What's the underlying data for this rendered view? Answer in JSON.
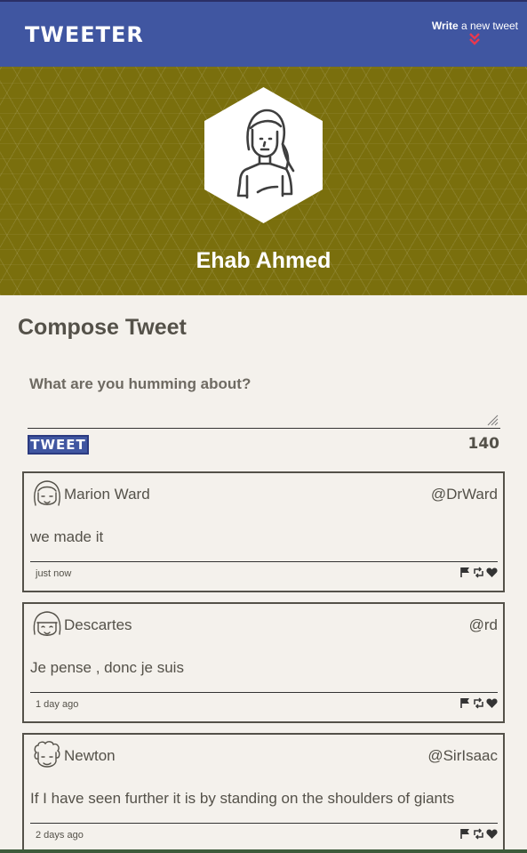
{
  "nav": {
    "logo": "TWEETER",
    "write_bold": "Write",
    "write_rest": " a new tweet"
  },
  "profile": {
    "name": "Ehab Ahmed"
  },
  "compose": {
    "title": "Compose Tweet",
    "placeholder": "What are you humming about?",
    "button_label": "TWEET",
    "counter": "140"
  },
  "tweets": [
    {
      "name": "Marion Ward",
      "handle": "@DrWard",
      "content": "we made it",
      "time": "just now",
      "avatar_icon": "girl-face-icon"
    },
    {
      "name": "Descartes",
      "handle": "@rd",
      "content": "Je pense , donc je suis",
      "time": "1 day ago",
      "avatar_icon": "bangs-face-icon"
    },
    {
      "name": "Newton",
      "handle": "@SirIsaac",
      "content": "If I have seen further it is by standing on the shoulders of giants",
      "time": "2 days ago",
      "avatar_icon": "curly-hair-face-icon"
    }
  ],
  "colors": {
    "nav_bg": "#4056a1",
    "header_bg": "#7a6f0d",
    "page_bg": "#f4f1ec",
    "text": "#545149",
    "accent_arrow": "#e8384f"
  }
}
